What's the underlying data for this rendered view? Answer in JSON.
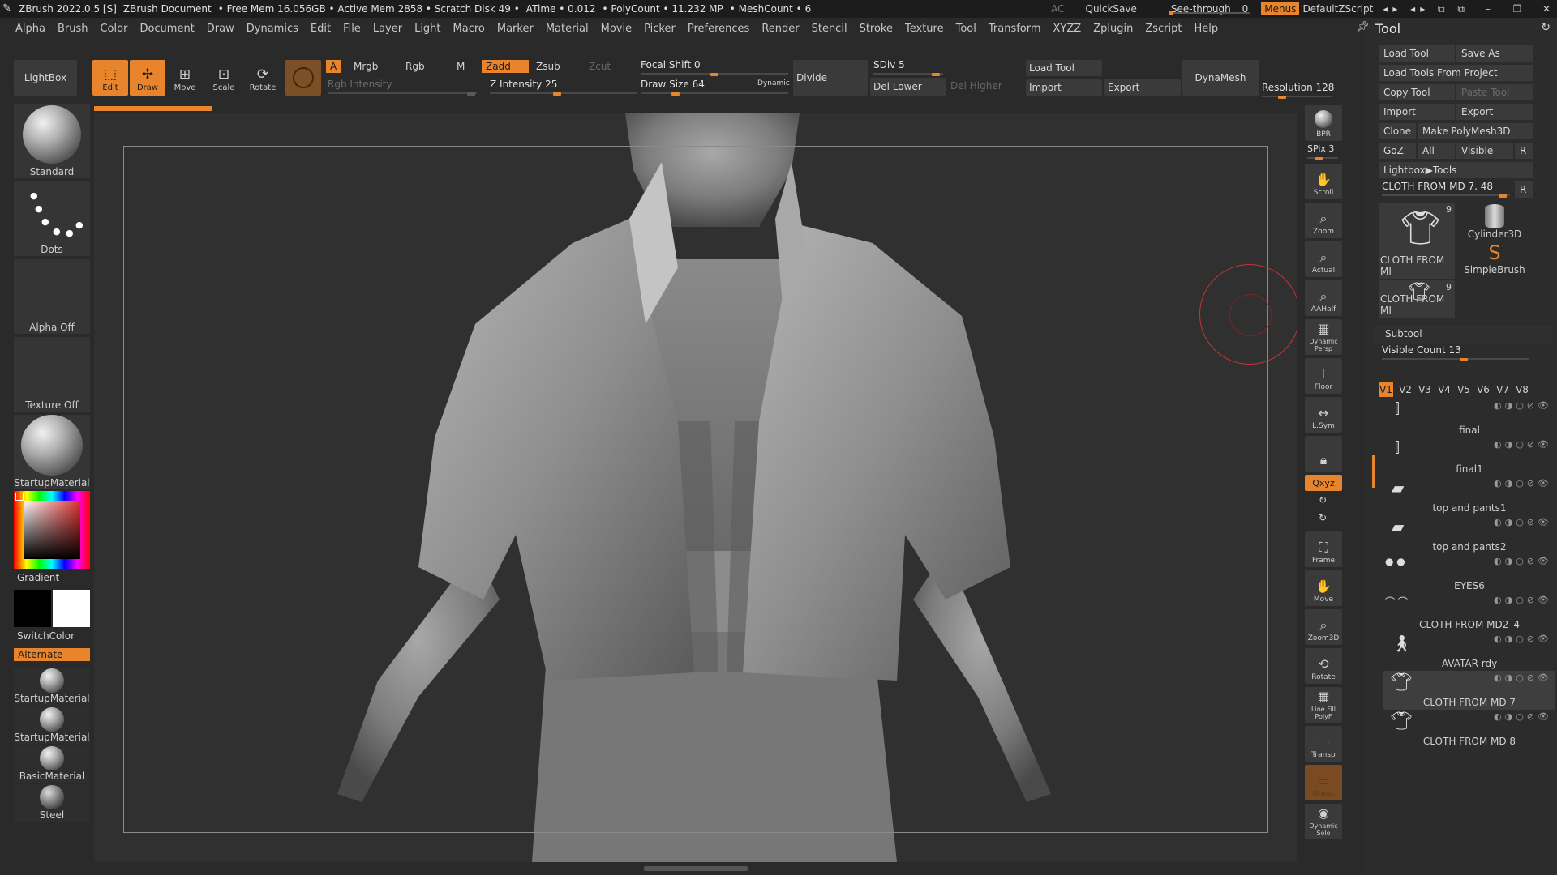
{
  "titlebar": {
    "app": "ZBrush 2022.0.5 [S]",
    "doc": "ZBrush Document",
    "stats": "• Free Mem 16.056GB • Active Mem 2858 • Scratch Disk 49 •",
    "atime": "ATime • 0.012",
    "polycount": "• PolyCount • 11.232 MP",
    "meshcount": "• MeshCount • 6",
    "ac": "AC",
    "quicksave": "QuickSave",
    "see_through": "See-through",
    "see_through_value": "0",
    "menus": "Menus",
    "default_zscript": "DefaultZScript"
  },
  "menubar": [
    "Alpha",
    "Brush",
    "Color",
    "Document",
    "Draw",
    "Dynamics",
    "Edit",
    "File",
    "Layer",
    "Light",
    "Macro",
    "Marker",
    "Material",
    "Movie",
    "Picker",
    "Preferences",
    "Render",
    "Stencil",
    "Stroke",
    "Texture",
    "Tool",
    "Transform",
    "XYZZ",
    "Zplugin",
    "Zscript",
    "Help"
  ],
  "toolbar": {
    "lightbox": "LightBox",
    "edit": "Edit",
    "draw": "Draw",
    "move": "Move",
    "scale": "Scale",
    "rotate": "Rotate",
    "a": "A",
    "mrgb": "Mrgb",
    "rgb": "Rgb",
    "m": "M",
    "zadd": "Zadd",
    "zsub": "Zsub",
    "zcut": "Zcut",
    "rgb_intensity": "Rgb Intensity",
    "z_intensity": "Z Intensity 25",
    "focal_shift": "Focal Shift 0",
    "draw_size": "Draw Size 64",
    "dynamic": "Dynamic",
    "divide": "Divide",
    "sdiv": "SDiv 5",
    "del_lower": "Del Lower",
    "del_higher": "Del Higher",
    "load_tool": "Load Tool",
    "import": "Import",
    "export": "Export",
    "dynamesh": "DynaMesh",
    "resolution": "Resolution 128",
    "z_intensity_value": 25,
    "focal_shift_value": 0,
    "draw_size_value": 64,
    "sdiv_value": 5,
    "resolution_value": 128
  },
  "leftshelf": {
    "standard": "Standard",
    "dots": "Dots",
    "alpha_off": "Alpha Off",
    "texture_off": "Texture Off",
    "startup_material": "StartupMaterial",
    "gradient": "Gradient",
    "switch_color": "SwitchColor",
    "alternate": "Alternate",
    "mat1": "StartupMaterial",
    "mat2": "StartupMaterial",
    "mat3": "BasicMaterial",
    "mat4": "Steel"
  },
  "rightshelf": {
    "bpr": "BPR",
    "spix": "SPix 3",
    "scroll": "Scroll",
    "zoom": "Zoom",
    "actual": "Actual",
    "aahalf": "AAHalf",
    "dynamic_persp": "Dynamic Persp",
    "floor": "Floor",
    "lsym": "L.Sym",
    "qxyz": "Qxyz",
    "frame": "Frame",
    "move": "Move",
    "zoom3d": "Zoom3D",
    "rotate": "Rotate",
    "linefill": "Line Fill PolyF",
    "transp": "Transp",
    "ghost": "Ghost",
    "solo": "Dynamic Solo"
  },
  "toolpanel": {
    "title": "Tool",
    "load_tool": "Load Tool",
    "save_as": "Save As",
    "load_from_project": "Load Tools From Project",
    "copy_tool": "Copy Tool",
    "paste_tool": "Paste Tool",
    "import": "Import",
    "export": "Export",
    "clone": "Clone",
    "make_polymesh": "Make PolyMesh3D",
    "goz": "GoZ",
    "all": "All",
    "visible": "Visible",
    "r": "R",
    "lightbox_tools": "Lightbox▶Tools",
    "current_tool": "CLOTH FROM MD 7. 48",
    "thumbs": [
      {
        "name": "CLOTH FROM MI",
        "count": "9"
      },
      {
        "name": "Cylinder3D"
      },
      {
        "name": "SimpleBrush"
      },
      {
        "name": "CLOTH FROM MI",
        "count": "9"
      }
    ],
    "subtool": "Subtool",
    "visible_count": "Visible Count 13",
    "visible_count_value": 13,
    "versions": [
      "V1",
      "V2",
      "V3",
      "V4",
      "V5",
      "V6",
      "V7",
      "V8"
    ],
    "subtools": [
      "final",
      "final1",
      "top and pants1",
      "top and pants2",
      "EYES6",
      "CLOTH FROM MD2_4",
      "AVATAR rdy",
      "CLOTH FROM MD 7",
      "CLOTH FROM MD 8"
    ]
  }
}
